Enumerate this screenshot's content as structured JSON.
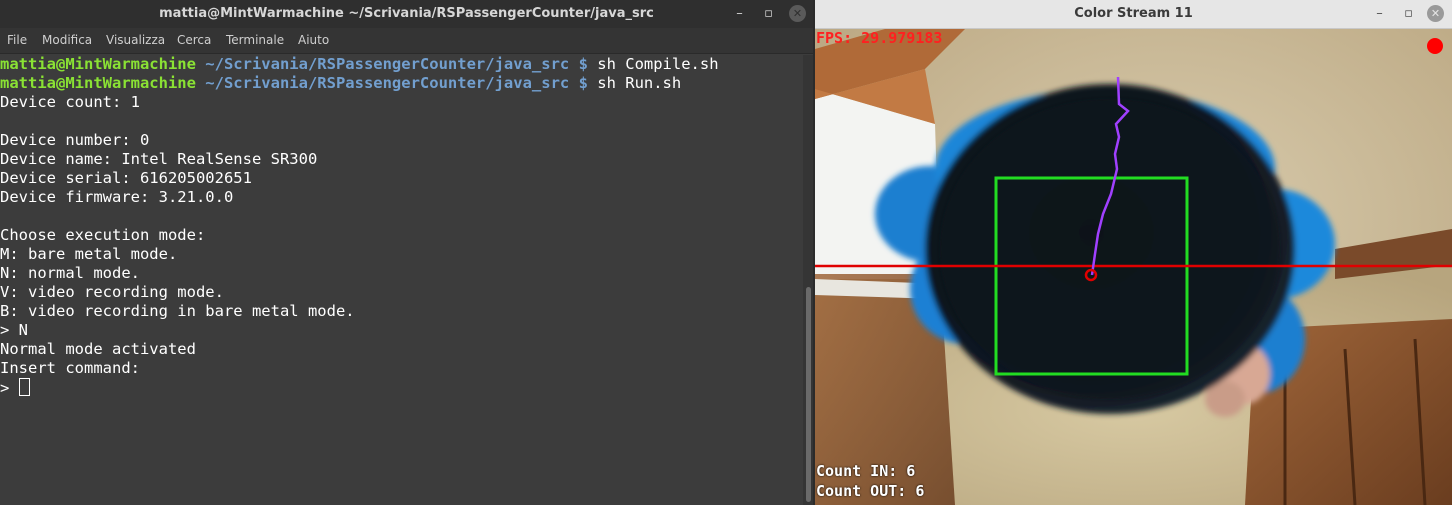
{
  "terminal": {
    "title": "mattia@MintWarmachine ~/Scrivania/RSPassengerCounter/java_src",
    "window_buttons": [
      "–",
      "▫",
      "✕"
    ],
    "menu": [
      "File",
      "Modifica",
      "Visualizza",
      "Cerca",
      "Terminale",
      "Aiuto"
    ],
    "prompt": {
      "user": "mattia@MintWarmachine",
      "path": " ~/Scrivania/RSPassengerCounter/java_src $"
    },
    "commands": [
      " sh Compile.sh",
      " sh Run.sh"
    ],
    "output_lines": [
      "Device count: 1",
      "",
      "Device number: 0",
      "Device name: Intel RealSense SR300",
      "Device serial: 616205002651",
      "Device firmware: 3.21.0.0",
      "",
      "Choose execution mode:",
      "M: bare metal mode.",
      "N: normal mode.",
      "V: video recording mode.",
      "B: video recording in bare metal mode.",
      "> N",
      "Normal mode activated",
      "Insert command:"
    ],
    "input_prompt": "> ",
    "colors": {
      "background": "#3c3c3c",
      "user": "#8ae234",
      "path": "#729fcf",
      "text": "#ffffff"
    }
  },
  "camera": {
    "title": "Color Stream 11",
    "window_buttons": [
      "–",
      "▫",
      "✕"
    ],
    "fps_label": "FPS: 29.979183",
    "count_in": "Count IN: 6",
    "count_out": "Count OUT: 6",
    "overlay_icons": [
      "recording-dot-icon",
      "tracking-box",
      "counting-line",
      "tracked-centroid-icon",
      "trajectory-line"
    ],
    "colors": {
      "fps": "#ff2020",
      "box": "#22dd22",
      "line": "#e00000",
      "trajectory": "#a040ff",
      "recording": "#ff0000"
    }
  }
}
